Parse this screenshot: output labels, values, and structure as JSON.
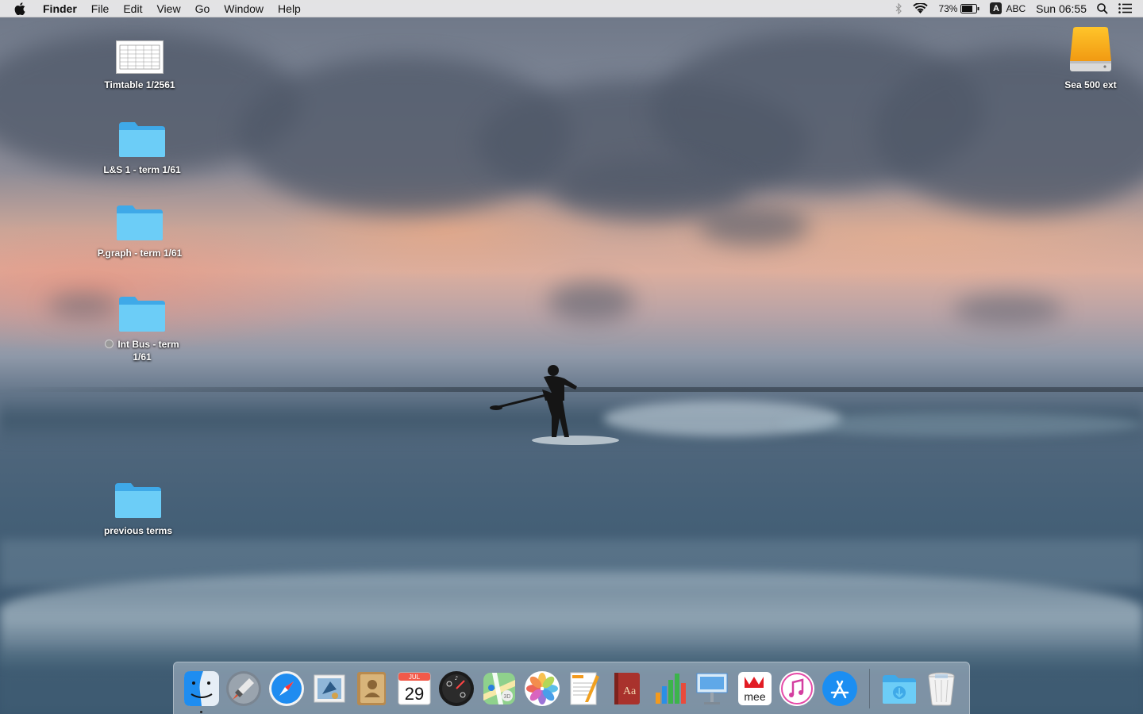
{
  "menubar": {
    "app_name": "Finder",
    "menus": [
      "File",
      "Edit",
      "View",
      "Go",
      "Window",
      "Help"
    ],
    "battery_percent": "73%",
    "input_source_badge": "A",
    "input_source_label": "ABC",
    "clock": "Sun 06:55"
  },
  "desktop": {
    "icons": [
      {
        "label": "Timtable 1/2561",
        "kind": "document"
      },
      {
        "label": "L&S 1 - term 1/61",
        "kind": "folder"
      },
      {
        "label": "P.graph - term 1/61",
        "kind": "folder"
      },
      {
        "label_line1": "Int Bus - term",
        "label_line2": "1/61",
        "kind": "folder",
        "tag": "gray"
      },
      {
        "label": "previous terms",
        "kind": "folder"
      },
      {
        "label": "Sea 500 ext",
        "kind": "external-drive"
      }
    ]
  },
  "dock": {
    "apps": [
      {
        "name": "finder",
        "running": true
      },
      {
        "name": "launchpad"
      },
      {
        "name": "safari"
      },
      {
        "name": "mail"
      },
      {
        "name": "contacts"
      },
      {
        "name": "calendar",
        "month": "JUL",
        "day": "29"
      },
      {
        "name": "dashboard"
      },
      {
        "name": "maps"
      },
      {
        "name": "photos"
      },
      {
        "name": "pages"
      },
      {
        "name": "dictionary",
        "glyph": "Aa"
      },
      {
        "name": "numbers"
      },
      {
        "name": "keynote"
      },
      {
        "name": "mee",
        "text": "mee"
      },
      {
        "name": "itunes"
      },
      {
        "name": "app-store"
      }
    ],
    "extras": [
      {
        "name": "downloads-folder"
      },
      {
        "name": "trash"
      }
    ]
  },
  "colors": {
    "folder_blue": "#5ec4f5",
    "menubar_bg": "#ececec",
    "drive_orange": "#f5a623"
  }
}
